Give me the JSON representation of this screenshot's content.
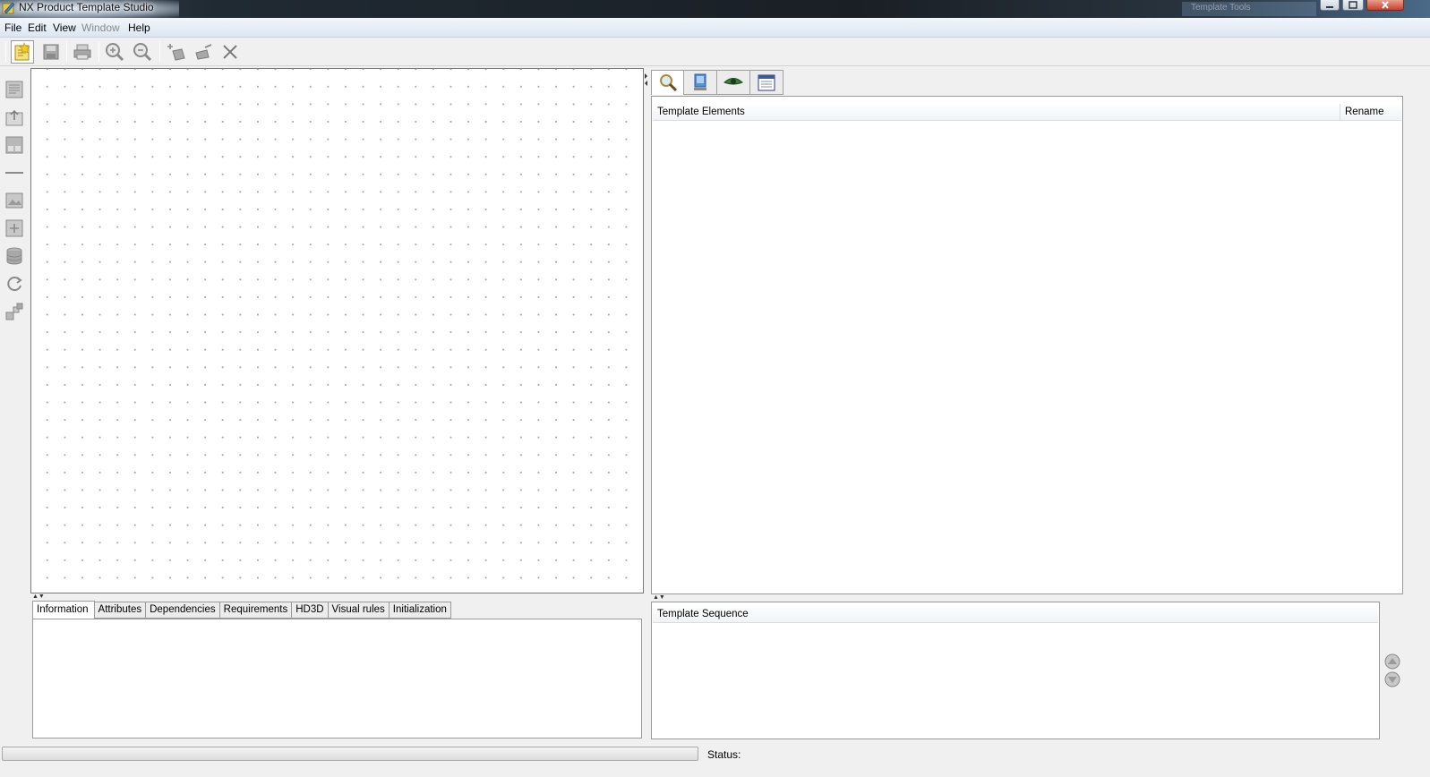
{
  "window": {
    "title": "NX Product Template Studio",
    "ghost_label": "Template Tools"
  },
  "menu": {
    "items": [
      {
        "label": "File",
        "enabled": true
      },
      {
        "label": "Edit",
        "enabled": true
      },
      {
        "label": "View",
        "enabled": true
      },
      {
        "label": "Window",
        "enabled": false
      },
      {
        "label": "Help",
        "enabled": true
      }
    ]
  },
  "toolbar": {
    "icons": [
      "new-template-icon",
      "save-icon",
      "print-icon",
      "zoom-in-icon",
      "zoom-out-icon",
      "add-element-icon",
      "edit-element-icon",
      "delete-icon"
    ]
  },
  "palette": {
    "icons": [
      "page-icon",
      "group-icon",
      "section-icon",
      "separator-icon",
      "image-icon",
      "add-item-icon",
      "database-icon",
      "refresh-icon",
      "blocks-icon"
    ]
  },
  "bottom_tabs": [
    {
      "label": "Information",
      "active": true
    },
    {
      "label": "Attributes",
      "active": false
    },
    {
      "label": "Dependencies",
      "active": false
    },
    {
      "label": "Requirements",
      "active": false
    },
    {
      "label": "HD3D",
      "active": false
    },
    {
      "label": "Visual rules",
      "active": false
    },
    {
      "label": "Initialization",
      "active": false
    }
  ],
  "right_tabs": {
    "icons": [
      "search-icon",
      "monitor-icon",
      "eye-icon",
      "calendar-window-icon"
    ]
  },
  "elements_table": {
    "columns": [
      "Template Elements",
      "Rename"
    ],
    "rows": []
  },
  "sequence": {
    "header": "Template Sequence",
    "rows": []
  },
  "status": {
    "label": "Status:",
    "value": ""
  },
  "colors": {
    "title_dark": "#1a1f25",
    "menubar_bg": "#dde6f0",
    "panel_bg": "#f0f0f0",
    "grid_dot": "#a8a8a8"
  }
}
